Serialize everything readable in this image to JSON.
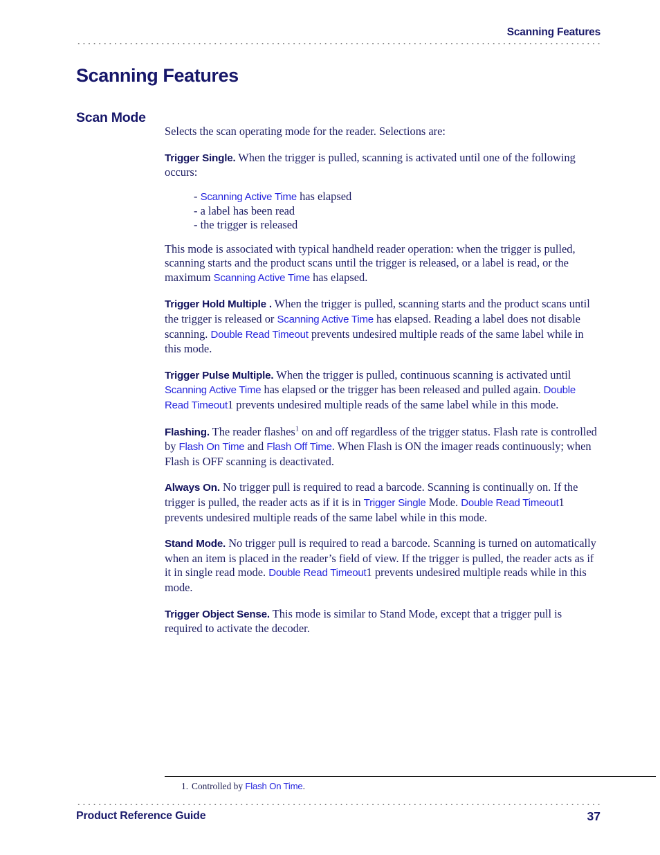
{
  "header": {
    "running_title": "Scanning Features"
  },
  "chapter": {
    "title": "Scanning Features"
  },
  "section": {
    "title": "Scan Mode"
  },
  "intro": {
    "text": "Selects the scan operating mode for the reader. Selections are:"
  },
  "trigger_single": {
    "label": "Trigger Single.",
    "text_1": " When the trigger is pulled, scanning is activated until one of the following occurs:",
    "bullets": [
      {
        "dash": "- ",
        "link": "Scanning Active Time",
        "rest": " has elapsed"
      },
      {
        "dash": "- ",
        "link": "",
        "rest": "a label has been read"
      },
      {
        "dash": "- ",
        "link": "",
        "rest": "the trigger is released"
      }
    ]
  },
  "mode_note": {
    "text_1": "This mode is associated with typical handheld reader operation: when the trigger is pulled, scanning starts and the product scans until the trigger is released, or a label is read, or the maximum ",
    "link_1": "Scanning Active Time",
    "text_2": " has elapsed."
  },
  "trigger_hold_multiple": {
    "label": "Trigger Hold Multiple .",
    "text_1": " When the trigger is pulled, scanning starts and the product scans until the trigger is released or ",
    "link_1": "Scanning Active Time",
    "text_2": " has elapsed. Reading a label does not disable scanning. ",
    "link_2": "Double Read Timeout",
    "text_3": " prevents undesired multiple reads of the same label while in this mode."
  },
  "trigger_pulse_multiple": {
    "label": "Trigger Pulse Multiple.",
    "text_1": " When the trigger is pulled, continuous scanning is activated until ",
    "link_1": "Scanning Active Time",
    "text_2": " has elapsed or the trigger has been released and pulled again. ",
    "link_2": "Double Read Timeout",
    "footnote_marker": "1",
    "text_3": " prevents undesired multiple reads of the same label while in this mode."
  },
  "flashing": {
    "label": "Flashing.",
    "text_1": " The reader flashes",
    "footnote_marker": "1",
    "text_2": " on and off regardless of the trigger status. Flash rate is controlled by ",
    "link_1": "Flash On Time",
    "text_3": " and ",
    "link_2": "Flash Off Time",
    "text_4": ". When Flash is ON the imager reads continuously; when Flash is OFF scanning is deactivated."
  },
  "always_on": {
    "label": "Always On.",
    "text_1": " No trigger pull is required to read a barcode. Scanning is continually on. If the trigger is pulled, the reader acts as if it is in ",
    "link_1": "Trigger Single",
    "text_2": " Mode. ",
    "link_2": "Double Read Timeout",
    "footnote_marker": "1",
    "text_3": " prevents undesired multiple reads of the same label while in this mode."
  },
  "stand_mode": {
    "label": "Stand Mode.",
    "text_1": " No trigger pull is required to read a barcode. Scanning is turned on automatically when an item is placed in the reader’s field of view. If the trigger is pulled, the reader acts as if it in single read mode. ",
    "link_1": "Double Read Timeout",
    "footnote_marker": "1",
    "text_2": " prevents undesired multiple reads while in this mode."
  },
  "trigger_object_sense": {
    "label": "Trigger Object Sense.",
    "text_1": " This mode is similar to Stand Mode, except that a trigger pull is required to activate the decoder."
  },
  "footnote": {
    "number": "1.",
    "text_1": "Controlled by ",
    "link": "Flash On Time",
    "text_2": "."
  },
  "footer": {
    "guide_title": "Product Reference Guide",
    "page_number": "37"
  },
  "colors": {
    "heading_navy": "#17176a",
    "body_navy": "#1d1d63",
    "link_blue": "#2626dd",
    "rule_gray": "#808080",
    "footnote_rule": "#000000"
  }
}
